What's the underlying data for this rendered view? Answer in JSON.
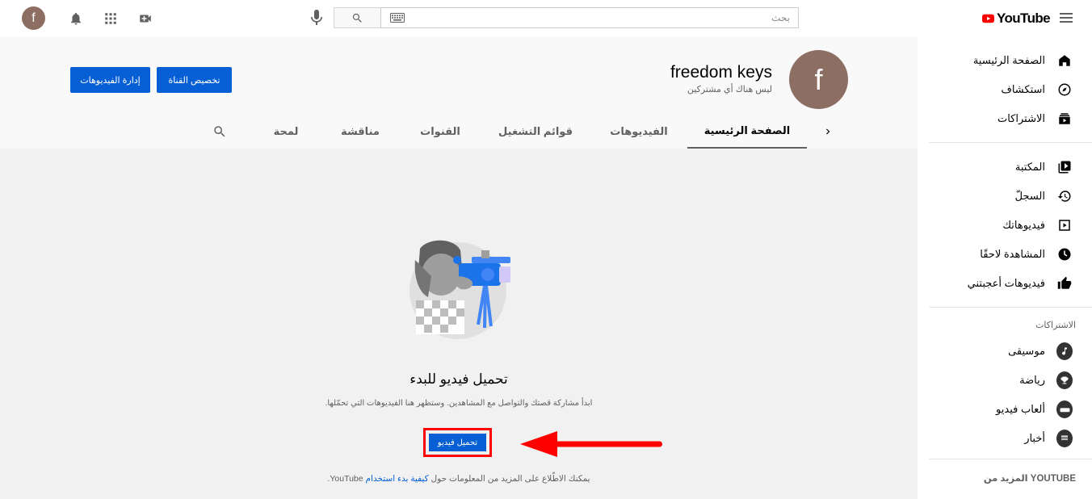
{
  "header": {
    "logo_text": "YouTube",
    "search_placeholder": "بحث",
    "avatar_letter": "f"
  },
  "channel": {
    "avatar_letter": "f",
    "name": "freedom keys",
    "subscribers": "ليس هناك أي مشتركين",
    "customize_label": "تخصيص القناة",
    "manage_label": "إدارة الفيديوهات"
  },
  "tabs": [
    {
      "label": "الصفحة الرئيسية",
      "active": true
    },
    {
      "label": "الفيديوهات"
    },
    {
      "label": "قوائم التشغيل"
    },
    {
      "label": "القنوات"
    },
    {
      "label": "مناقشة"
    },
    {
      "label": "لمحة"
    }
  ],
  "empty_state": {
    "title": "تحميل فيديو للبدء",
    "description": "ابدأ مشاركة قصتك والتواصل مع المشاهدين. وستظهر هنا الفيديوهات التي تحمّلها.",
    "upload_label": "تحميل فيديو",
    "learn_prefix": "يمكنك الاطّلاع على المزيد من المعلومات حول",
    "learn_link": "كيفية بدء استخدام",
    "learn_suffix": "YouTube."
  },
  "sidebar": {
    "main": [
      {
        "label": "الصفحة الرئيسية",
        "icon": "home-icon"
      },
      {
        "label": "استكشاف",
        "icon": "compass-icon"
      },
      {
        "label": "الاشتراكات",
        "icon": "subscriptions-icon"
      }
    ],
    "library": [
      {
        "label": "المكتبة",
        "icon": "library-icon"
      },
      {
        "label": "السجلّ",
        "icon": "history-icon"
      },
      {
        "label": "فيديوهاتك",
        "icon": "your-videos-icon"
      },
      {
        "label": "المشاهدة لاحقًا",
        "icon": "clock-icon"
      },
      {
        "label": "فيديوهات أعجبتني",
        "icon": "thumbs-up-icon"
      }
    ],
    "subscriptions_heading": "الاشتراكات",
    "subscriptions": [
      {
        "label": "موسيقى",
        "icon": "music-icon"
      },
      {
        "label": "رياضة",
        "icon": "trophy-icon"
      },
      {
        "label": "ألعاب فيديو",
        "icon": "gaming-icon"
      },
      {
        "label": "أخبار",
        "icon": "news-icon"
      }
    ],
    "more_heading": "المزيد من YOUTUBE"
  },
  "colors": {
    "accent": "#065fd4",
    "brand_red": "#ff0000",
    "highlight": "#ff0000"
  }
}
